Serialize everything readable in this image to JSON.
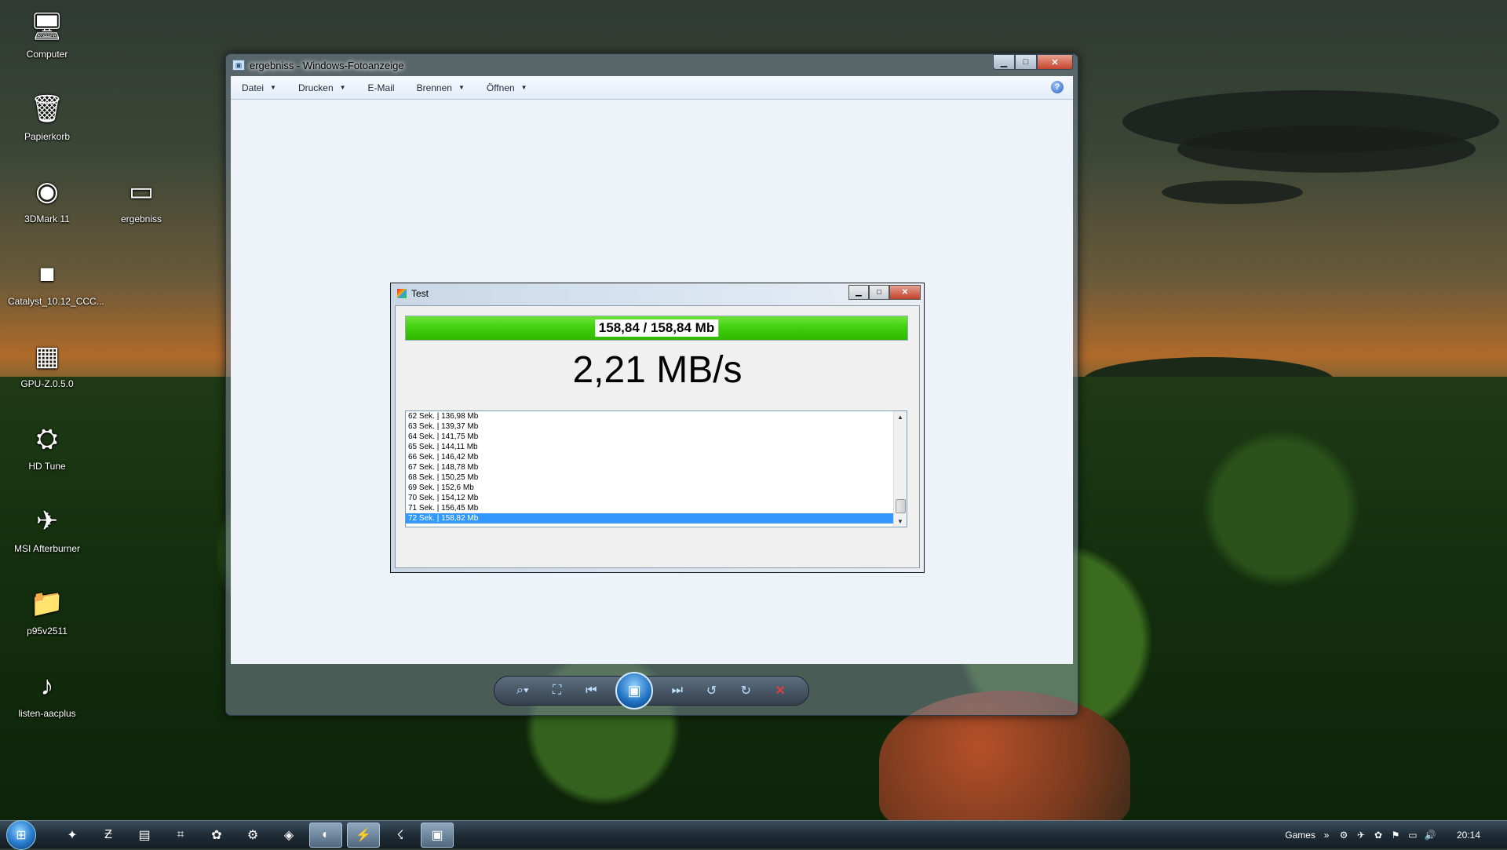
{
  "desktop": {
    "icons": [
      {
        "label": "Computer",
        "icon": "computer-icon",
        "glyph": "🖥"
      },
      {
        "label": "Papierkorb",
        "icon": "recycle-bin-icon",
        "glyph": "🗑"
      },
      {
        "label": "3DMark 11",
        "icon": "3dmark-icon",
        "glyph": "◉"
      },
      {
        "label": "ergebniss",
        "icon": "image-file-icon",
        "glyph": "▭"
      },
      {
        "label": "Catalyst_10.12_CCC...",
        "icon": "catalyst-icon",
        "glyph": "■"
      },
      {
        "label": "GPU-Z.0.5.0",
        "icon": "gpuz-icon",
        "glyph": "▦"
      },
      {
        "label": "HD Tune",
        "icon": "hdtune-icon",
        "glyph": "⛭"
      },
      {
        "label": "MSI Afterburner",
        "icon": "afterburner-icon",
        "glyph": "✈"
      },
      {
        "label": "p95v2511",
        "icon": "folder-icon",
        "glyph": "📁"
      },
      {
        "label": "listen-aacplus",
        "icon": "playlist-file-icon",
        "glyph": "♪"
      }
    ]
  },
  "photo_viewer": {
    "title": "ergebniss - Windows-Fotoanzeige",
    "menu": [
      {
        "label": "Datei",
        "has_dropdown": true
      },
      {
        "label": "Drucken",
        "has_dropdown": true
      },
      {
        "label": "E-Mail",
        "has_dropdown": false
      },
      {
        "label": "Brennen",
        "has_dropdown": true
      },
      {
        "label": "Öffnen",
        "has_dropdown": true
      }
    ]
  },
  "test_window": {
    "title": "Test",
    "progress": {
      "label": "158,84 / 158,84 Mb",
      "fraction": 1.0
    },
    "speed": "2,21 MB/s",
    "log": [
      "62 Sek. | 136,98 Mb",
      "63 Sek. | 139,37 Mb",
      "64 Sek. | 141,75 Mb",
      "65 Sek. | 144,11 Mb",
      "66 Sek. | 146,42 Mb",
      "67 Sek. | 148,78 Mb",
      "68 Sek. | 150,25 Mb",
      "69 Sek. | 152,6 Mb",
      "70 Sek. | 154,12 Mb",
      "71 Sek. | 156,45 Mb",
      "72 Sek. | 158,82 Mb"
    ],
    "selected_index": 10
  },
  "taskbar": {
    "toolbar_label": "Games",
    "clock": "20:14"
  },
  "colors": {
    "progress_green": "#3fcf0c",
    "selection_blue": "#3399ff",
    "close_red": "#c5452e"
  }
}
